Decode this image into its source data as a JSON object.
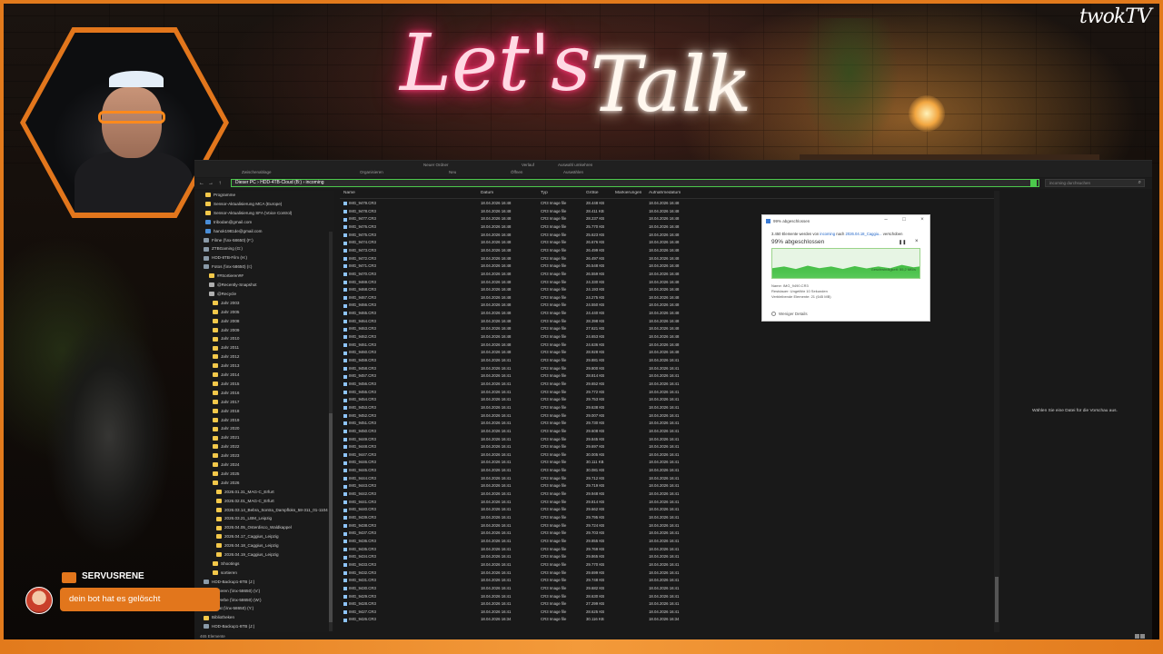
{
  "overlay": {
    "banner_lets": "Let's",
    "banner_talk": "Talk",
    "logo": "twokTV",
    "chat_name": "SERVUSRENE",
    "chat_message": "dein bot hat es gelöscht"
  },
  "ribbon": {
    "items": [
      "Zwischenablage",
      "Organisieren",
      "Neu",
      "Öffnen",
      "Auswählen",
      "Neuer Ordner",
      "Verlauf",
      "Auswahl umkehren"
    ]
  },
  "address": {
    "path": "Dieser PC  ›  HDD-4TB-Cloud (B:)  ›  incoming",
    "search_placeholder": "incoming durchsuchen"
  },
  "columns": {
    "name": "Name",
    "date": "Datum",
    "type": "Typ",
    "size": "Größe",
    "tags": "Markierungen",
    "taken": "Aufnahmedatum"
  },
  "sidebar": [
    {
      "label": "Programme",
      "icon": "folder"
    },
    {
      "label": "Sensor-Aktualisierung MCA (Europe)",
      "icon": "folder"
    },
    {
      "label": "Sensor-Aktualisierung SFA (Voice Control)",
      "icon": "folder"
    },
    {
      "label": "tribodan@gmail.com",
      "icon": "mail"
    },
    {
      "label": "hanok1981de@gmail.com",
      "icon": "mail"
    },
    {
      "label": "Filme (\\\\nx-58650) (F:)",
      "icon": "drive"
    },
    {
      "label": "ZTBGaming (G:)",
      "icon": "drive"
    },
    {
      "label": "HDD-8TB-Film (H:)",
      "icon": "drive"
    },
    {
      "label": "Fotos (\\\\nx-58650) (I:)",
      "icon": "drive"
    },
    {
      "label": "##Sortieren##",
      "icon": "folder"
    },
    {
      "label": "@Recently-Snapshot",
      "icon": "special"
    },
    {
      "label": "@Recycle",
      "icon": "special"
    },
    {
      "label": "Jahr 2003",
      "icon": "folder"
    },
    {
      "label": "Jahr 2005",
      "icon": "folder"
    },
    {
      "label": "Jahr 2008",
      "icon": "folder"
    },
    {
      "label": "Jahr 2009",
      "icon": "folder"
    },
    {
      "label": "Jahr 2010",
      "icon": "folder"
    },
    {
      "label": "Jahr 2011",
      "icon": "folder"
    },
    {
      "label": "Jahr 2012",
      "icon": "folder"
    },
    {
      "label": "Jahr 2013",
      "icon": "folder"
    },
    {
      "label": "Jahr 2014",
      "icon": "folder"
    },
    {
      "label": "Jahr 2015",
      "icon": "folder"
    },
    {
      "label": "Jahr 2016",
      "icon": "folder"
    },
    {
      "label": "Jahr 2017",
      "icon": "folder"
    },
    {
      "label": "Jahr 2018",
      "icon": "folder"
    },
    {
      "label": "Jahr 2019",
      "icon": "folder"
    },
    {
      "label": "Jahr 2020",
      "icon": "folder"
    },
    {
      "label": "Jahr 2021",
      "icon": "folder"
    },
    {
      "label": "Jahr 2022",
      "icon": "folder"
    },
    {
      "label": "Jahr 2023",
      "icon": "folder"
    },
    {
      "label": "Jahr 2024",
      "icon": "folder"
    },
    {
      "label": "Jahr 2025",
      "icon": "folder"
    },
    {
      "label": "Jahr 2026",
      "icon": "folder"
    },
    {
      "label": "2026.01.31_MAG-C_Erfurt",
      "icon": "folder"
    },
    {
      "label": "2026.02.01_MAG-C_Erfurt",
      "icon": "folder"
    },
    {
      "label": "2026.03.14_Bebra_Sontra_Dampfloks_58-311_01-1104",
      "icon": "folder"
    },
    {
      "label": "2026.03.21_LBM_Leipzig",
      "icon": "folder"
    },
    {
      "label": "2026.04.05_Osterdisco_Waldkappel",
      "icon": "folder"
    },
    {
      "label": "2026.04.17_Caggius_Leipzig",
      "icon": "folder"
    },
    {
      "label": "2026.04.18_Caggius_Leipzig",
      "icon": "folder"
    },
    {
      "label": "2026.04.19_Caggius_Leipzig",
      "icon": "folder"
    },
    {
      "label": "Shootings",
      "icon": "folder"
    },
    {
      "label": "sortieren",
      "icon": "folder"
    },
    {
      "label": "HDD-Backup1-8TB (J:)",
      "icon": "drive"
    },
    {
      "label": "Sortieren (\\\\nx-58650) (V:)",
      "icon": "drive"
    },
    {
      "label": "Gewerbe (\\\\nx-58650) (W:)",
      "icon": "drive"
    },
    {
      "label": "Privat (\\\\nx-58650) (Y:)",
      "icon": "drive"
    },
    {
      "label": "Bibliotheken",
      "icon": "folder"
    },
    {
      "label": "HDD-Backup1-8TB (J:)",
      "icon": "drive"
    }
  ],
  "files": [
    {
      "name": "IMG_9479.CR3",
      "date": "18.04.2026 16:48",
      "type": "CR3 Image file",
      "size": "28.448 KB",
      "taken": "18.04.2026 16:48"
    },
    {
      "name": "IMG_9478.CR3",
      "date": "18.04.2026 16:48",
      "type": "CR3 Image file",
      "size": "28.411 KB",
      "taken": "18.04.2026 16:48"
    },
    {
      "name": "IMG_9477.CR3",
      "date": "18.04.2026 16:48",
      "type": "CR3 Image file",
      "size": "28.237 KB",
      "taken": "18.04.2026 16:48"
    },
    {
      "name": "IMG_9476.CR3",
      "date": "18.04.2026 16:48",
      "type": "CR3 Image file",
      "size": "25.770 KB",
      "taken": "18.04.2026 16:48"
    },
    {
      "name": "IMG_9475.CR3",
      "date": "18.04.2026 16:48",
      "type": "CR3 Image file",
      "size": "25.623 KB",
      "taken": "18.04.2026 16:48"
    },
    {
      "name": "IMG_9474.CR3",
      "date": "18.04.2026 16:48",
      "type": "CR3 Image file",
      "size": "26.676 KB",
      "taken": "18.04.2026 16:48"
    },
    {
      "name": "IMG_9473.CR3",
      "date": "18.04.2026 16:48",
      "type": "CR3 Image file",
      "size": "26.499 KB",
      "taken": "18.04.2026 16:48"
    },
    {
      "name": "IMG_9472.CR3",
      "date": "18.04.2026 16:48",
      "type": "CR3 Image file",
      "size": "26.497 KB",
      "taken": "18.04.2026 16:48"
    },
    {
      "name": "IMG_9471.CR3",
      "date": "18.04.2026 16:48",
      "type": "CR3 Image file",
      "size": "26.548 KB",
      "taken": "18.04.2026 16:48"
    },
    {
      "name": "IMG_9470.CR3",
      "date": "18.04.2026 16:48",
      "type": "CR3 Image file",
      "size": "26.559 KB",
      "taken": "18.04.2026 16:48"
    },
    {
      "name": "IMG_9469.CR3",
      "date": "18.04.2026 16:48",
      "type": "CR3 Image file",
      "size": "24.330 KB",
      "taken": "18.04.2026 16:48"
    },
    {
      "name": "IMG_9468.CR3",
      "date": "18.04.2026 16:48",
      "type": "CR3 Image file",
      "size": "24.193 KB",
      "taken": "18.04.2026 16:48"
    },
    {
      "name": "IMG_9467.CR3",
      "date": "18.04.2026 16:48",
      "type": "CR3 Image file",
      "size": "24.275 KB",
      "taken": "18.04.2026 16:48"
    },
    {
      "name": "IMG_9466.CR3",
      "date": "18.04.2026 16:48",
      "type": "CR3 Image file",
      "size": "24.550 KB",
      "taken": "18.04.2026 16:48"
    },
    {
      "name": "IMG_9465.CR3",
      "date": "18.04.2026 16:48",
      "type": "CR3 Image file",
      "size": "24.440 KB",
      "taken": "18.04.2026 16:48"
    },
    {
      "name": "IMG_9464.CR3",
      "date": "18.04.2026 16:48",
      "type": "CR3 Image file",
      "size": "28.398 KB",
      "taken": "18.04.2026 16:48"
    },
    {
      "name": "IMG_9463.CR3",
      "date": "18.04.2026 16:48",
      "type": "CR3 Image file",
      "size": "27.621 KB",
      "taken": "18.04.2026 16:48"
    },
    {
      "name": "IMG_9462.CR3",
      "date": "18.04.2026 16:48",
      "type": "CR3 Image file",
      "size": "24.653 KB",
      "taken": "18.04.2026 16:48"
    },
    {
      "name": "IMG_9461.CR3",
      "date": "18.04.2026 16:48",
      "type": "CR3 Image file",
      "size": "24.636 KB",
      "taken": "18.04.2026 16:48"
    },
    {
      "name": "IMG_9460.CR3",
      "date": "18.04.2026 16:48",
      "type": "CR3 Image file",
      "size": "28.928 KB",
      "taken": "18.04.2026 16:48"
    },
    {
      "name": "IMG_9459.CR3",
      "date": "18.04.2026 16:41",
      "type": "CR3 Image file",
      "size": "29.881 KB",
      "taken": "18.04.2026 16:41"
    },
    {
      "name": "IMG_9458.CR3",
      "date": "18.04.2026 16:41",
      "type": "CR3 Image file",
      "size": "29.800 KB",
      "taken": "18.04.2026 16:41"
    },
    {
      "name": "IMG_9457.CR3",
      "date": "18.04.2026 16:41",
      "type": "CR3 Image file",
      "size": "28.814 KB",
      "taken": "18.04.2026 16:41"
    },
    {
      "name": "IMG_9456.CR3",
      "date": "18.04.2026 16:41",
      "type": "CR3 Image file",
      "size": "29.652 KB",
      "taken": "18.04.2026 16:41"
    },
    {
      "name": "IMG_9455.CR3",
      "date": "18.04.2026 16:41",
      "type": "CR3 Image file",
      "size": "29.772 KB",
      "taken": "18.04.2026 16:41"
    },
    {
      "name": "IMG_9454.CR3",
      "date": "18.04.2026 16:41",
      "type": "CR3 Image file",
      "size": "29.753 KB",
      "taken": "18.04.2026 16:41"
    },
    {
      "name": "IMG_9453.CR3",
      "date": "18.04.2026 16:41",
      "type": "CR3 Image file",
      "size": "29.638 KB",
      "taken": "18.04.2026 16:41"
    },
    {
      "name": "IMG_9452.CR3",
      "date": "18.04.2026 16:41",
      "type": "CR3 Image file",
      "size": "29.007 KB",
      "taken": "18.04.2026 16:41"
    },
    {
      "name": "IMG_9451.CR3",
      "date": "18.04.2026 16:41",
      "type": "CR3 Image file",
      "size": "29.730 KB",
      "taken": "18.04.2026 16:41"
    },
    {
      "name": "IMG_9450.CR3",
      "date": "18.04.2026 16:41",
      "type": "CR3 Image file",
      "size": "29.608 KB",
      "taken": "18.04.2026 16:41"
    },
    {
      "name": "IMG_9449.CR3",
      "date": "18.04.2026 16:41",
      "type": "CR3 Image file",
      "size": "29.845 KB",
      "taken": "18.04.2026 16:41"
    },
    {
      "name": "IMG_9448.CR3",
      "date": "18.04.2026 16:41",
      "type": "CR3 Image file",
      "size": "29.697 KB",
      "taken": "18.04.2026 16:41"
    },
    {
      "name": "IMG_9447.CR3",
      "date": "18.04.2026 16:41",
      "type": "CR3 Image file",
      "size": "30.005 KB",
      "taken": "18.04.2026 16:41"
    },
    {
      "name": "IMG_9446.CR3",
      "date": "18.04.2026 16:41",
      "type": "CR3 Image file",
      "size": "30.111 KB",
      "taken": "18.04.2026 16:41"
    },
    {
      "name": "IMG_9445.CR3",
      "date": "18.04.2026 16:41",
      "type": "CR3 Image file",
      "size": "30.081 KB",
      "taken": "18.04.2026 16:41"
    },
    {
      "name": "IMG_9444.CR3",
      "date": "18.04.2026 16:41",
      "type": "CR3 Image file",
      "size": "29.712 KB",
      "taken": "18.04.2026 16:41"
    },
    {
      "name": "IMG_9443.CR3",
      "date": "18.04.2026 16:41",
      "type": "CR3 Image file",
      "size": "29.719 KB",
      "taken": "18.04.2026 16:41"
    },
    {
      "name": "IMG_9442.CR3",
      "date": "18.04.2026 16:41",
      "type": "CR3 Image file",
      "size": "29.948 KB",
      "taken": "18.04.2026 16:41"
    },
    {
      "name": "IMG_9441.CR3",
      "date": "18.04.2026 16:41",
      "type": "CR3 Image file",
      "size": "29.814 KB",
      "taken": "18.04.2026 16:41"
    },
    {
      "name": "IMG_9440.CR3",
      "date": "18.04.2026 16:41",
      "type": "CR3 Image file",
      "size": "29.662 KB",
      "taken": "18.04.2026 16:41"
    },
    {
      "name": "IMG_9439.CR3",
      "date": "18.04.2026 16:41",
      "type": "CR3 Image file",
      "size": "29.795 KB",
      "taken": "18.04.2026 16:41"
    },
    {
      "name": "IMG_9438.CR3",
      "date": "18.04.2026 16:41",
      "type": "CR3 Image file",
      "size": "29.724 KB",
      "taken": "18.04.2026 16:41"
    },
    {
      "name": "IMG_9437.CR3",
      "date": "18.04.2026 16:41",
      "type": "CR3 Image file",
      "size": "29.703 KB",
      "taken": "18.04.2026 16:41"
    },
    {
      "name": "IMG_9436.CR3",
      "date": "18.04.2026 16:41",
      "type": "CR3 Image file",
      "size": "29.855 KB",
      "taken": "18.04.2026 16:41"
    },
    {
      "name": "IMG_9435.CR3",
      "date": "18.04.2026 16:41",
      "type": "CR3 Image file",
      "size": "29.769 KB",
      "taken": "18.04.2026 16:41"
    },
    {
      "name": "IMG_9434.CR3",
      "date": "18.04.2026 16:41",
      "type": "CR3 Image file",
      "size": "29.865 KB",
      "taken": "18.04.2026 16:41"
    },
    {
      "name": "IMG_9433.CR3",
      "date": "18.04.2026 16:41",
      "type": "CR3 Image file",
      "size": "29.770 KB",
      "taken": "18.04.2026 16:41"
    },
    {
      "name": "IMG_9432.CR3",
      "date": "18.04.2026 16:41",
      "type": "CR3 Image file",
      "size": "29.699 KB",
      "taken": "18.04.2026 16:41"
    },
    {
      "name": "IMG_9431.CR3",
      "date": "18.04.2026 16:41",
      "type": "CR3 Image file",
      "size": "29.748 KB",
      "taken": "18.04.2026 16:41"
    },
    {
      "name": "IMG_9430.CR3",
      "date": "18.04.2026 16:41",
      "type": "CR3 Image file",
      "size": "29.682 KB",
      "taken": "18.04.2026 16:41"
    },
    {
      "name": "IMG_9429.CR3",
      "date": "18.04.2026 16:41",
      "type": "CR3 Image file",
      "size": "28.630 KB",
      "taken": "18.04.2026 16:41"
    },
    {
      "name": "IMG_9428.CR3",
      "date": "18.04.2026 16:41",
      "type": "CR3 Image file",
      "size": "27.299 KB",
      "taken": "18.04.2026 16:41"
    },
    {
      "name": "IMG_9427.CR3",
      "date": "18.04.2026 16:41",
      "type": "CR3 Image file",
      "size": "28.625 KB",
      "taken": "18.04.2026 16:41"
    },
    {
      "name": "IMG_9426.CR3",
      "date": "18.04.2026 16:34",
      "type": "CR3 Image file",
      "size": "30.116 KB",
      "taken": "18.04.2026 16:34"
    }
  ],
  "preview_message": "Wählen Sie eine Datei für die Vorschau aus.",
  "status": "465 Elemente",
  "dialog": {
    "title": "99% abgeschlossen",
    "desc_prefix": "3.450 Elemente werden von",
    "desc_src": "incoming",
    "desc_mid": "nach",
    "desc_dst": "2026.04.18_Caggiu...",
    "desc_suffix": "verschoben",
    "percent": "99% abgeschlossen",
    "speed": "Geschwindigkeit: 55,2 MB/s",
    "name_line": "Name:  IMG_9490.CR3",
    "remaining_time": "Restdauer: Ungefähr 10 Sekunden",
    "remaining_items": "Verbleibende Elemente: 21 (645 MB)",
    "less_details": "Weniger Details"
  }
}
